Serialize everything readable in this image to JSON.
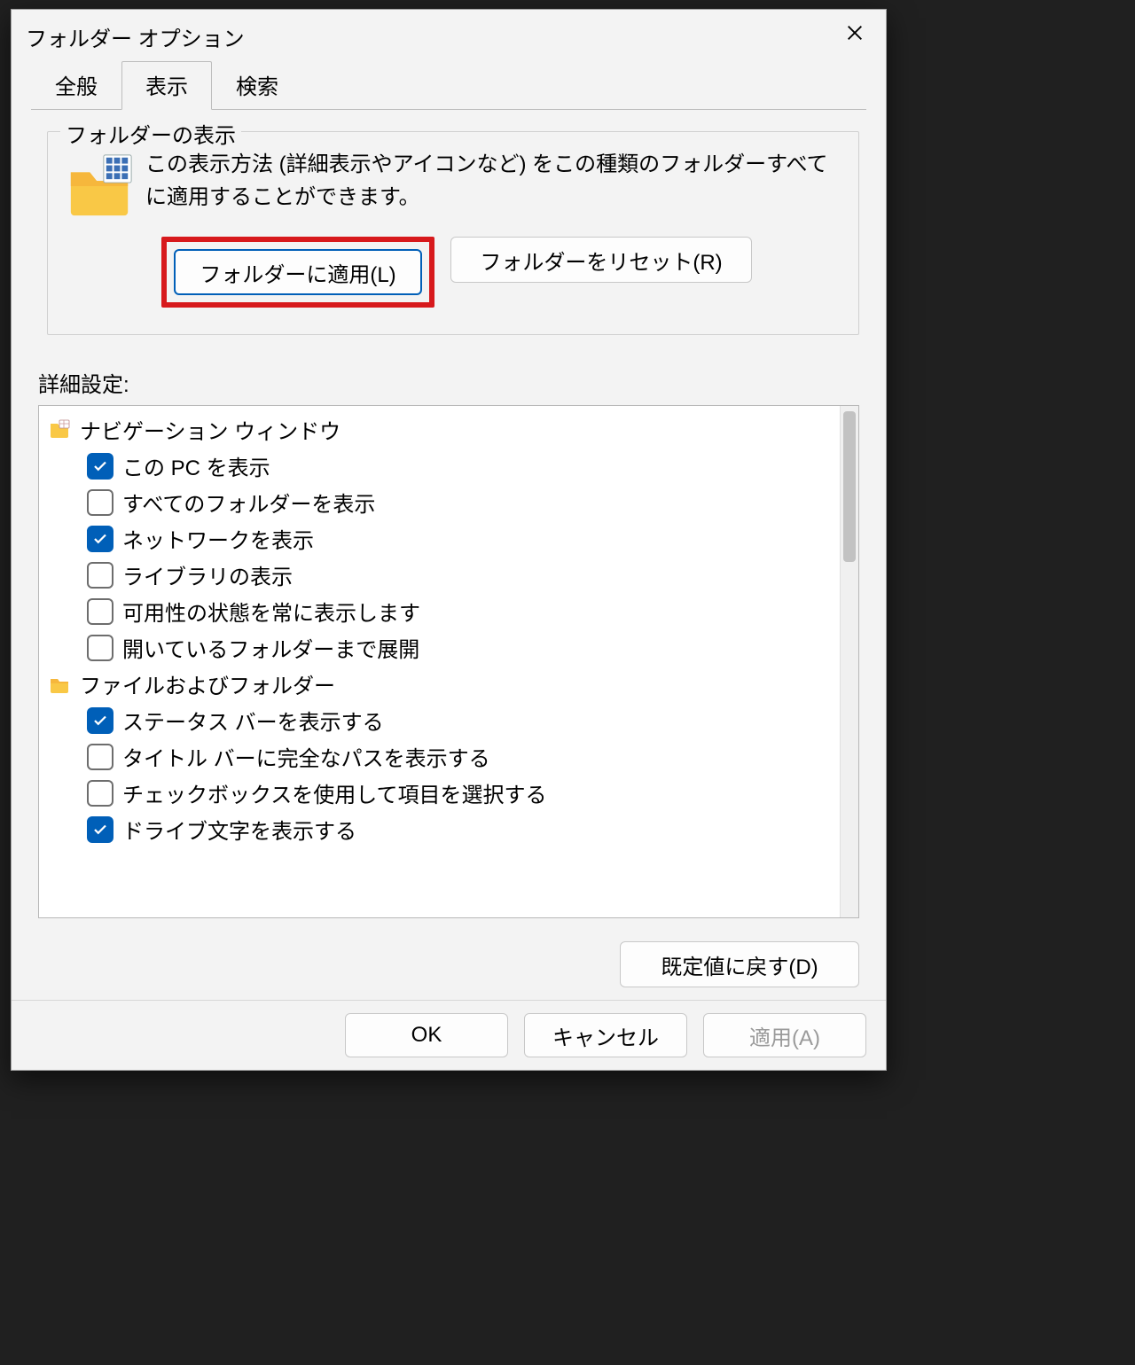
{
  "dialog": {
    "title": "フォルダー オプション"
  },
  "tabs": {
    "general": "全般",
    "view": "表示",
    "search": "検索"
  },
  "group": {
    "legend": "フォルダーの表示",
    "desc": "この表示方法 (詳細表示やアイコンなど) をこの種類のフォルダーすべてに適用することができます。",
    "apply_btn": "フォルダーに適用(L)",
    "reset_btn": "フォルダーをリセット(R)"
  },
  "advanced": {
    "label": "詳細設定:",
    "groups": [
      {
        "icon": "tree-icon",
        "label": "ナビゲーション ウィンドウ",
        "items": [
          {
            "checked": true,
            "label": "この PC を表示"
          },
          {
            "checked": false,
            "label": "すべてのフォルダーを表示"
          },
          {
            "checked": true,
            "label": "ネットワークを表示"
          },
          {
            "checked": false,
            "label": "ライブラリの表示"
          },
          {
            "checked": false,
            "label": "可用性の状態を常に表示します"
          },
          {
            "checked": false,
            "label": "開いているフォルダーまで展開"
          }
        ]
      },
      {
        "icon": "folder-icon",
        "label": "ファイルおよびフォルダー",
        "items": [
          {
            "checked": true,
            "label": "ステータス バーを表示する"
          },
          {
            "checked": false,
            "label": "タイトル バーに完全なパスを表示する"
          },
          {
            "checked": false,
            "label": "チェックボックスを使用して項目を選択する"
          },
          {
            "checked": true,
            "label": "ドライブ文字を表示する"
          }
        ]
      }
    ]
  },
  "restore_defaults": "既定値に戻す(D)",
  "footer": {
    "ok": "OK",
    "cancel": "キャンセル",
    "apply": "適用(A)"
  }
}
